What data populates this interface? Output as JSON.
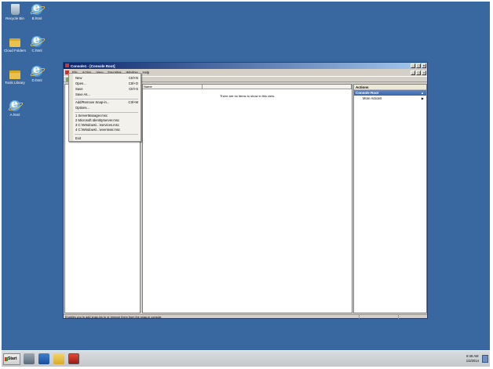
{
  "desktop": {
    "icons": [
      {
        "label": "Recycle Bin",
        "icon": "recycle-bin-icon"
      },
      {
        "label": "B.html",
        "icon": "ie-html-icon"
      },
      {
        "label": "Cloud Folders",
        "icon": "folder-icon"
      },
      {
        "label": "C.html",
        "icon": "ie-html-icon"
      },
      {
        "label": "D.html",
        "icon": "ie-html-icon"
      },
      {
        "label": "Tools Library",
        "icon": "folder-icon"
      },
      {
        "label": "A.html",
        "icon": "ie-html-icon"
      }
    ]
  },
  "window": {
    "title": "Console1 - [Console Root]",
    "menu": [
      "File",
      "Action",
      "View",
      "Favorites",
      "Window",
      "Help"
    ],
    "center": {
      "column_name": "Name",
      "empty_text": "There are no items to show in this view."
    },
    "actions": {
      "header": "Actions",
      "section": "Console Root",
      "items": [
        "More Actions"
      ]
    },
    "status": "Enables you to add snap-ins to or remove them from the snap-in console."
  },
  "file_menu": [
    {
      "label": "New",
      "shortcut": "Ctrl+N"
    },
    {
      "label": "Open...",
      "shortcut": "Ctrl+O"
    },
    {
      "label": "Save",
      "shortcut": "Ctrl+S"
    },
    {
      "label": "Save As...",
      "shortcut": ""
    },
    {
      "label": "Add/Remove Snap-in...",
      "shortcut": "Ctrl+M"
    },
    {
      "label": "Options...",
      "shortcut": ""
    },
    {
      "label": "1 ServerManager.msc",
      "shortcut": ""
    },
    {
      "label": "2 Microsoft.IdentityServer.msc",
      "shortcut": ""
    },
    {
      "label": "3 C:\\Windows\\...\\services.msc",
      "shortcut": ""
    },
    {
      "label": "4 C:\\Windows\\...\\eventvwr.msc",
      "shortcut": ""
    },
    {
      "label": "Exit",
      "shortcut": ""
    }
  ],
  "taskbar": {
    "start_label": "Start",
    "time": "8:49 AM",
    "date": "1/3/2014"
  },
  "colors": {
    "desktop": "#39679f",
    "titlebar_start": "#0a246a",
    "actions_section": "#3c66a8"
  }
}
